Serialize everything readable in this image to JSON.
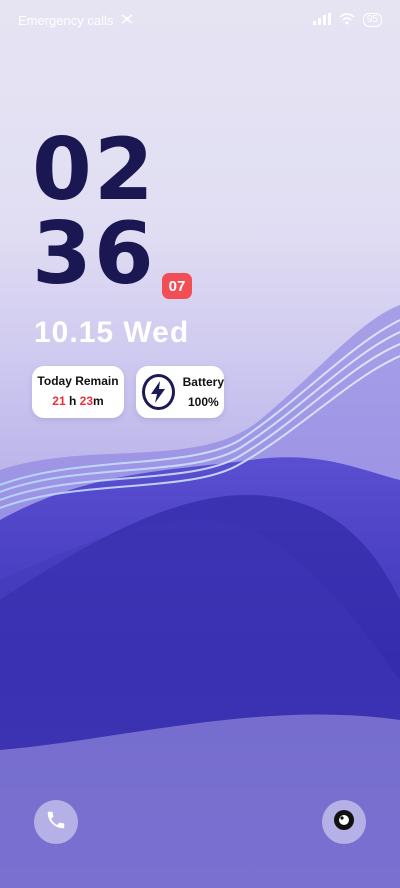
{
  "status_bar": {
    "carrier_text": "Emergency calls",
    "battery_level": "95"
  },
  "clock": {
    "hours": "02",
    "minutes": "36",
    "seconds": "07"
  },
  "date": "10.15 Wed",
  "widgets": {
    "remain": {
      "title": "Today Remain",
      "hours_value": "21",
      "hours_unit": "h",
      "minutes_value": "23",
      "minutes_unit": "m"
    },
    "battery": {
      "title": "Battery",
      "value": "100%"
    }
  },
  "shortcuts": {
    "left_icon": "phone-icon",
    "right_icon": "camera-icon"
  },
  "colors": {
    "clock_text": "#1a1753",
    "accent_red": "#ef2e36"
  }
}
